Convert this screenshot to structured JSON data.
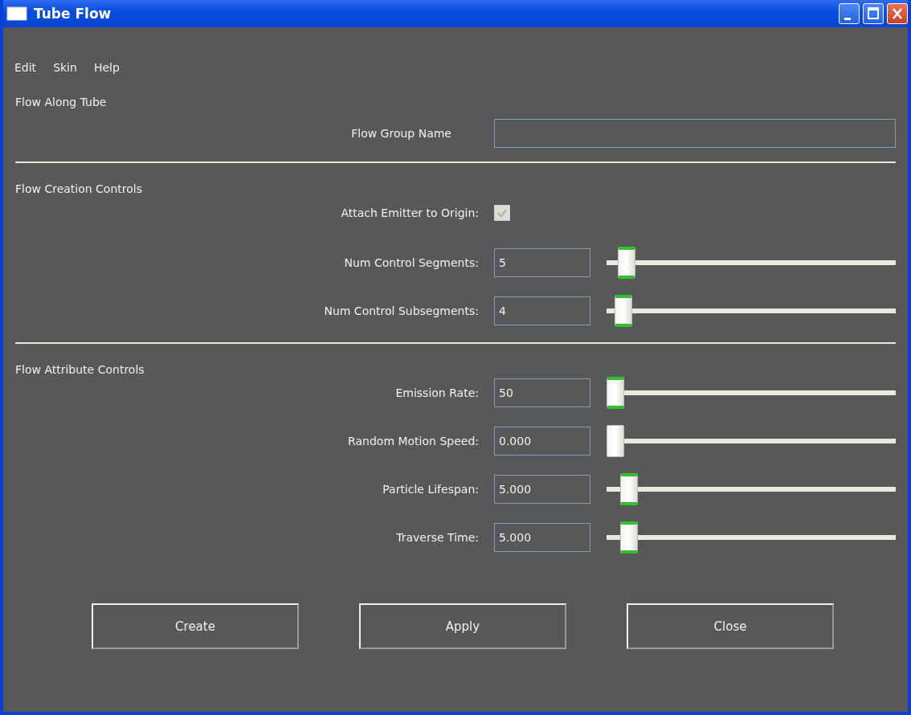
{
  "window": {
    "title": "Tube Flow"
  },
  "menu": [
    "Edit",
    "Skin",
    "Help"
  ],
  "sections": [
    {
      "title": "Flow Along Tube",
      "rows": [
        {
          "kind": "text",
          "label": "Flow Group Name"
        }
      ]
    },
    {
      "title": "Flow Creation Controls",
      "rows": [
        {
          "kind": "checkbox",
          "label": "Attach Emitter to Origin:",
          "checked": true,
          "disabled": true
        },
        {
          "kind": "slider",
          "label": "Num Control Segments:",
          "value": "5",
          "level": 0.04,
          "active": true
        },
        {
          "kind": "slider",
          "label": "Num Control Subsegments:",
          "value": "4",
          "level": 0.03,
          "active": true
        }
      ]
    },
    {
      "title": "Flow Attribute Controls",
      "rows": [
        {
          "kind": "slider",
          "label": "Emission Rate:",
          "value": "50",
          "level": 0.0,
          "active": true
        },
        {
          "kind": "slider",
          "label": "Random Motion Speed:",
          "value": "0.000",
          "level": 0.0,
          "active": false
        },
        {
          "kind": "slider",
          "label": "Particle Lifespan:",
          "value": "5.000",
          "level": 0.05,
          "active": true
        },
        {
          "kind": "slider",
          "label": "Traverse Time:",
          "value": "5.000",
          "level": 0.05,
          "active": true
        }
      ]
    }
  ],
  "buttons": [
    "Create",
    "Apply",
    "Close"
  ]
}
